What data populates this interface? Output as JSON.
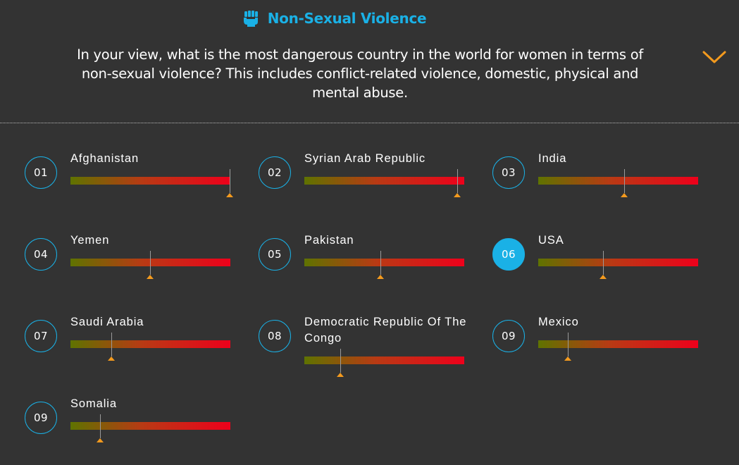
{
  "header": {
    "title": "Non-Sexual Violence",
    "title_icon": "fist-icon",
    "question": "In your view, what is the most dangerous country in the world for women in terms of non-sexual violence? This includes conflict-related violence, domestic, physical and mental abuse.",
    "collapse_icon": "chevron-down-icon"
  },
  "colors": {
    "accent": "#1ab1e6",
    "background": "#333333",
    "marker": "#f39a1e",
    "bar_start": "#5f7300",
    "bar_end": "#ee001b"
  },
  "items": [
    {
      "rank": "01",
      "country": "Afghanistan",
      "score": 1.0,
      "active": false
    },
    {
      "rank": "02",
      "country": "Syrian Arab Republic",
      "score": 0.96,
      "active": false
    },
    {
      "rank": "03",
      "country": "India",
      "score": 0.54,
      "active": false
    },
    {
      "rank": "04",
      "country": "Yemen",
      "score": 0.5,
      "active": false
    },
    {
      "rank": "05",
      "country": "Pakistan",
      "score": 0.48,
      "active": false
    },
    {
      "rank": "06",
      "country": "USA",
      "score": 0.41,
      "active": true
    },
    {
      "rank": "07",
      "country": "Saudi Arabia",
      "score": 0.26,
      "active": false
    },
    {
      "rank": "08",
      "country": "Democratic Republic Of The Congo",
      "score": 0.23,
      "active": false
    },
    {
      "rank": "09",
      "country": "Mexico",
      "score": 0.19,
      "active": false
    },
    {
      "rank": "09",
      "country": "Somalia",
      "score": 0.19,
      "active": false
    }
  ]
}
